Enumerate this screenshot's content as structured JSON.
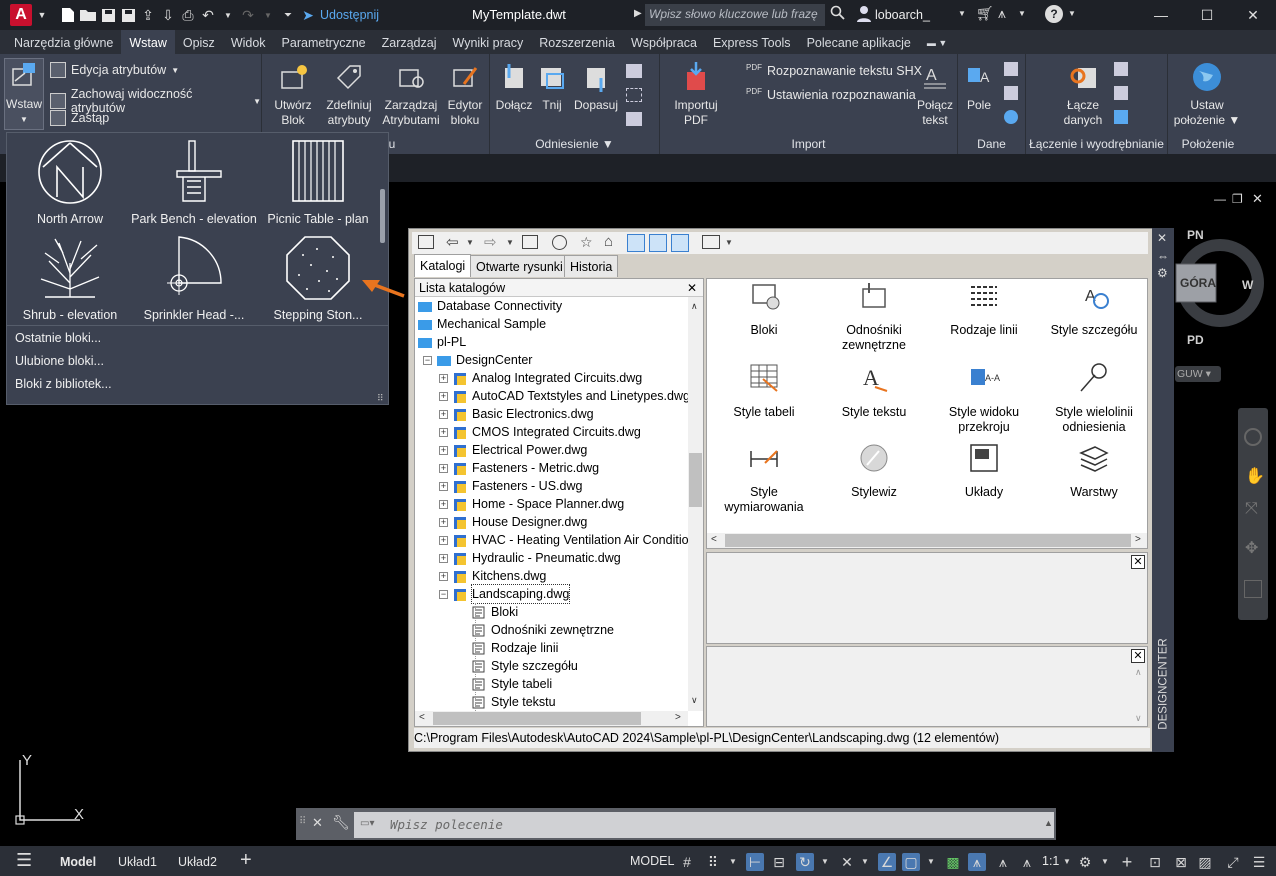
{
  "app": {
    "title": "MyTemplate.dwt",
    "share_label": "Udostępnij",
    "search_placeholder": "Wpisz słowo kluczowe lub frazę",
    "user": "loboarch_"
  },
  "ribbon_tabs": [
    "Narzędzia główne",
    "Wstaw",
    "Opisz",
    "Widok",
    "Parametryczne",
    "Zarządzaj",
    "Wyniki pracy",
    "Rozszerzenia",
    "Współpraca",
    "Express Tools",
    "Polecane aplikacje"
  ],
  "ribbon": {
    "insert_btn": "Wstaw",
    "edit_attr": "Edycja atrybutów",
    "keep_attr_vis": "Zachowaj widoczność atrybutów",
    "replace": "Zastąp",
    "create_block": [
      "Utwórz",
      "Blok"
    ],
    "define_attr": [
      "Zdefiniuj",
      "atrybuty"
    ],
    "manage_attr": [
      "Zarządzaj",
      "Atrybutami"
    ],
    "block_editor": [
      "Edytor",
      "bloku"
    ],
    "block_panel_title": "oku",
    "attach": "Dołącz",
    "clip": "Tnij",
    "adjust": "Dopasuj",
    "reference_title": "Odniesienie",
    "import_pdf": [
      "Importuj",
      "PDF"
    ],
    "shx_recognize": "Rozpoznawanie tekstu SHX",
    "recognize_settings": "Ustawienia rozpoznawania",
    "combine_text": [
      "Połącz",
      "tekst"
    ],
    "import_title": "Import",
    "field": "Pole",
    "data_title": "Dane",
    "data_links": [
      "Łącze",
      "danych"
    ],
    "linking_title": "Łączenie i wyodrębnianie",
    "set_location": [
      "Ustaw",
      "położenie"
    ],
    "location_title": "Położenie"
  },
  "gallery": {
    "items": [
      "North Arrow",
      "Park Bench - elevation",
      "Picnic Table - plan",
      "Shrub - elevation",
      "Sprinkler Head -...",
      "Stepping Ston..."
    ],
    "menu": [
      "Ostatnie bloki...",
      "Ulubione bloki...",
      "Bloki z bibliotek..."
    ]
  },
  "designcenter": {
    "tabs": [
      "Katalogi",
      "Otwarte rysunki",
      "Historia"
    ],
    "tree_header": "Lista katalogów",
    "tree": [
      "Database Connectivity",
      "Mechanical Sample",
      "pl-PL",
      "DesignCenter",
      "Analog Integrated Circuits.dwg",
      "AutoCAD Textstyles and Linetypes.dwg",
      "Basic Electronics.dwg",
      "CMOS Integrated Circuits.dwg",
      "Electrical Power.dwg",
      "Fasteners - Metric.dwg",
      "Fasteners - US.dwg",
      "Home - Space Planner.dwg",
      "House Designer.dwg",
      "HVAC - Heating Ventilation Air Conditio",
      "Hydraulic - Pneumatic.dwg",
      "Kitchens.dwg",
      "Landscaping.dwg",
      "Bloki",
      "Odnośniki zewnętrzne",
      "Rodzaje linii",
      "Style szczegółu",
      "Style tabeli",
      "Style tekstu"
    ],
    "content": [
      [
        "Bloki"
      ],
      [
        "Odnośniki",
        "zewnętrzne"
      ],
      [
        "Rodzaje linii"
      ],
      [
        "Style szczegółu"
      ],
      [
        "Style tabeli"
      ],
      [
        "Style tekstu"
      ],
      [
        "Style widoku",
        "przekroju"
      ],
      [
        "Style wielolinii",
        "odniesienia"
      ],
      [
        "Style wymiarowania"
      ],
      [
        "Stylewiz"
      ],
      [
        "Układy"
      ],
      [
        "Warstwy"
      ]
    ],
    "status": "C:\\Program Files\\Autodesk\\AutoCAD 2024\\Sample\\pl-PL\\DesignCenter\\Landscaping.dwg (12 elementów)",
    "side_label": "DESIGNCENTER"
  },
  "viewcube": {
    "north": "PN",
    "south": "PD",
    "east": "W",
    "face": "GÓRA",
    "wcs": "GUW"
  },
  "command": {
    "placeholder": "Wpisz polecenie"
  },
  "statusbar": {
    "tabs": [
      "Model",
      "Układ1",
      "Układ2"
    ],
    "model_btn": "MODEL",
    "scale": "1:1"
  },
  "ucs": {
    "x": "X",
    "y": "Y"
  },
  "colors": {
    "accent_orange": "#e8741f",
    "ribbon_bg": "#3b4150",
    "titlebar_bg": "#1e2127",
    "active_blue": "#4a78b0"
  }
}
